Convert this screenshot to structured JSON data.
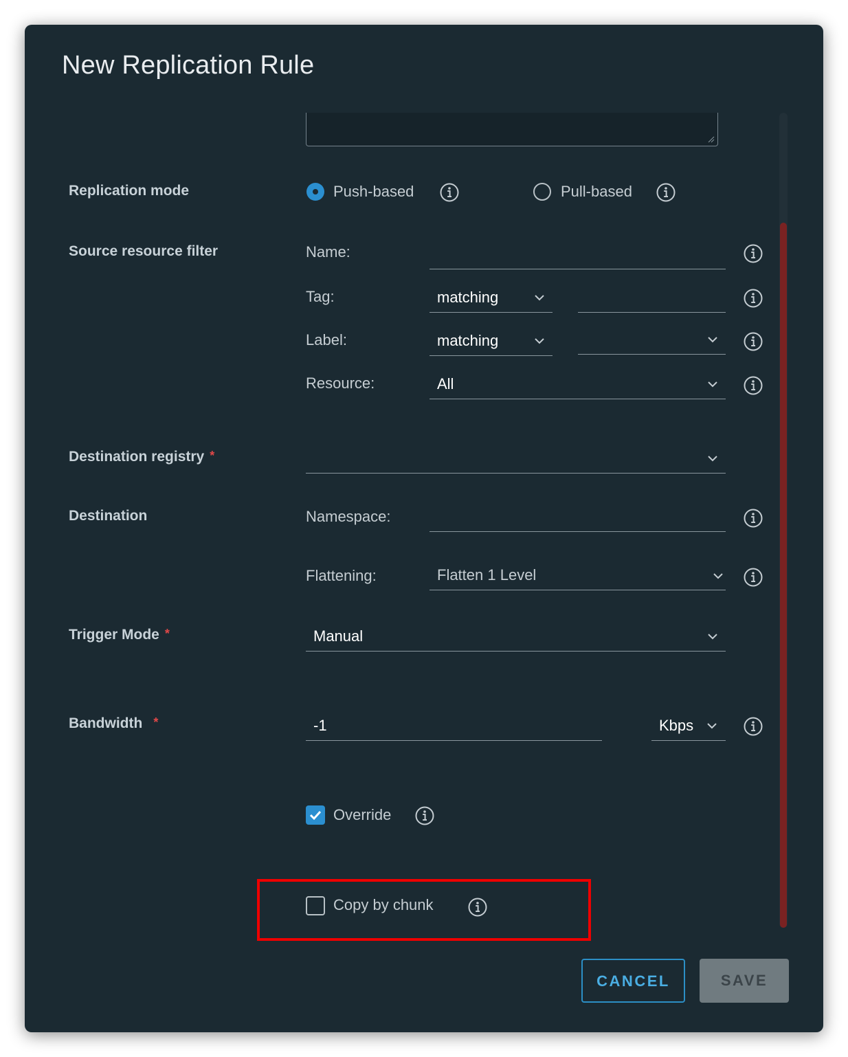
{
  "dialog": {
    "title": "New Replication Rule"
  },
  "replication_mode": {
    "label": "Replication mode",
    "options": [
      {
        "label": "Push-based",
        "selected": true
      },
      {
        "label": "Pull-based",
        "selected": false
      }
    ]
  },
  "source_filter": {
    "label": "Source resource filter",
    "name": {
      "label": "Name:",
      "value": ""
    },
    "tag": {
      "label": "Tag:",
      "mode": "matching",
      "value": ""
    },
    "label_filter": {
      "label": "Label:",
      "mode": "matching",
      "value": ""
    },
    "resource": {
      "label": "Resource:",
      "value": "All"
    }
  },
  "destination_registry": {
    "label": "Destination registry",
    "required_mark": "*",
    "value": ""
  },
  "destination": {
    "label": "Destination",
    "namespace": {
      "label": "Namespace:",
      "value": ""
    },
    "flattening": {
      "label": "Flattening:",
      "value": "Flatten 1 Level"
    }
  },
  "trigger_mode": {
    "label": "Trigger Mode",
    "required_mark": "*",
    "value": "Manual"
  },
  "bandwidth": {
    "label": "Bandwidth",
    "required_mark": "*",
    "value": "-1",
    "unit": "Kbps"
  },
  "override": {
    "label": "Override",
    "checked": true
  },
  "copy_by_chunk": {
    "label": "Copy by chunk",
    "checked": false
  },
  "footer": {
    "cancel_label": "CANCEL",
    "save_label": "SAVE"
  },
  "colors": {
    "modal_bg": "#1b2a32",
    "accent": "#2c8fc6",
    "checkbox_checked": "#2b8fd0",
    "required": "#e04848",
    "highlight": "#ee0000",
    "scroll_thumb": "#7a2222"
  }
}
